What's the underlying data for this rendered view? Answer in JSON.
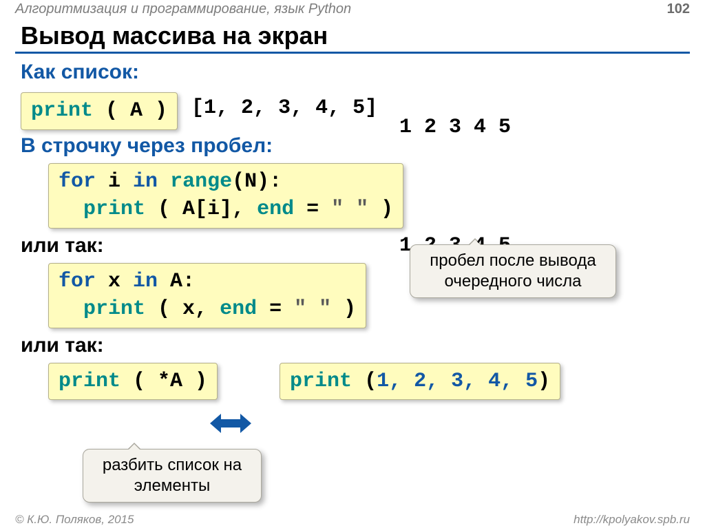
{
  "header": {
    "subject": "Алгоритмизация и программирование, язык Python",
    "page": "102"
  },
  "title": "Вывод массива на экран",
  "labels": {
    "as_list": "Как список:",
    "in_row": "В строчку через пробел:",
    "or1": "или так:",
    "or2": "или так:"
  },
  "code": {
    "c1_print": "print",
    "c1_rest": " ( A )",
    "c1_out": "[1, 2, 3, 4, 5]",
    "c2_l1_a": "for",
    "c2_l1_b": " i ",
    "c2_l1_c": "in",
    "c2_l1_d": " ",
    "c2_l1_e": "range",
    "c2_l1_f": "(N):",
    "c2_l2_a": "  ",
    "c2_l2_b": "print",
    "c2_l2_c": " ( A[i], ",
    "c2_l2_d": "end",
    "c2_l2_e": " = ",
    "c2_l2_f": "\" \"",
    "c2_l2_g": " )",
    "c3_l1_a": "for",
    "c3_l1_b": " x ",
    "c3_l1_c": "in",
    "c3_l1_d": " A:",
    "c3_l2_a": "  ",
    "c3_l2_b": "print",
    "c3_l2_c": " ( x, ",
    "c3_l2_d": "end",
    "c3_l2_e": " = ",
    "c3_l2_f": "\" \"",
    "c3_l2_g": " )",
    "c4_a": "print",
    "c4_b": " ( *A )",
    "c5_a": "print",
    "c5_b": " (",
    "c5_c": "1, 2, 3, 4, 5",
    "c5_d": ")"
  },
  "outputs": {
    "o1": "1 2 3 4 5",
    "o2": "1 2 3 4 5"
  },
  "callouts": {
    "c1": "пробел после вывода очередного числа",
    "c2": "разбить список на элементы"
  },
  "footer": {
    "left": "© К.Ю. Поляков, 2015",
    "right": "http://kpolyakov.spb.ru"
  }
}
